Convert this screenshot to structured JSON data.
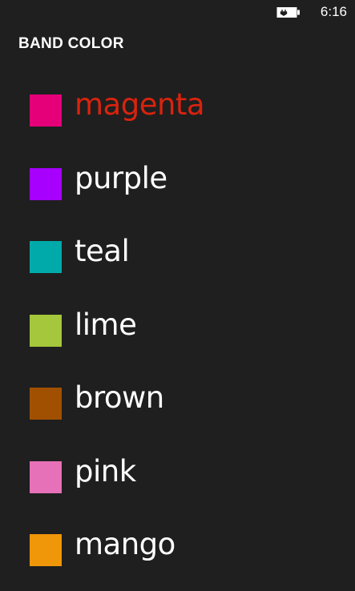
{
  "status_bar": {
    "time": "6:16",
    "battery_icon": "battery-charging-icon"
  },
  "page": {
    "title": "BAND COLOR"
  },
  "colors": [
    {
      "label": "magenta",
      "swatch": "#e5007a",
      "selected": true
    },
    {
      "label": "purple",
      "swatch": "#a700ff",
      "selected": false
    },
    {
      "label": "teal",
      "swatch": "#00aaab",
      "selected": false
    },
    {
      "label": "lime",
      "swatch": "#a4c73b",
      "selected": false
    },
    {
      "label": "brown",
      "swatch": "#a05000",
      "selected": false
    },
    {
      "label": "pink",
      "swatch": "#e671b8",
      "selected": false
    },
    {
      "label": "mango",
      "swatch": "#f09609",
      "selected": false
    }
  ],
  "accent_color": "#d9230e"
}
